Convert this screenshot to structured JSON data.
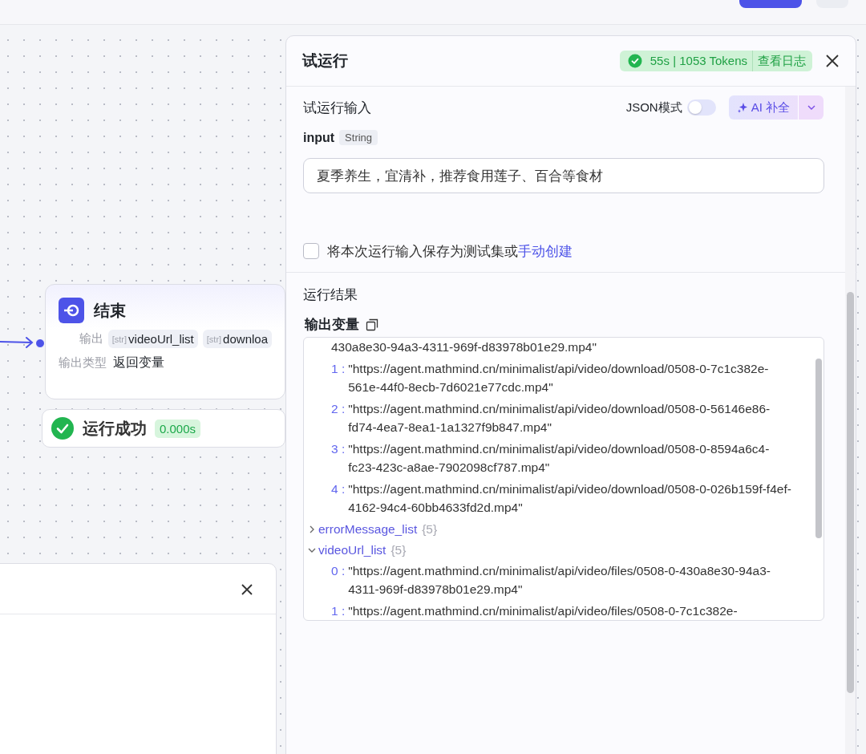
{
  "canvas": {
    "end_node": {
      "title": "结束",
      "output_label": "输出",
      "outputs": [
        {
          "type": "[str]",
          "name": "videoUrl_list"
        },
        {
          "type": "[str]",
          "name": "downloa"
        }
      ],
      "output_type_label": "输出类型",
      "output_type": "返回变量"
    },
    "run_status": {
      "text": "运行成功",
      "time": "0.000s"
    }
  },
  "test_panel": {
    "title": "试运行",
    "status": {
      "summary": "55s | 1053 Tokens",
      "log_link": "查看日志"
    },
    "input_section": {
      "title": "试运行输入",
      "json_mode_label": "JSON模式",
      "json_mode_on": false,
      "ai_button": "AI 补全"
    },
    "fields": [
      {
        "name": "input",
        "type": "String",
        "value": "夏季养生，宜清补，推荐食用莲子、百合等食材"
      }
    ],
    "save_option": {
      "checked": false,
      "text": "将本次运行输入保存为测试集或",
      "link": "手动创建"
    },
    "result": {
      "title": "运行结果",
      "output_label": "输出变量",
      "lines": [
        {
          "kind": "continuation",
          "value": "430a8e30-94a3-4311-969f-d83978b01e29.mp4\""
        },
        {
          "kind": "item",
          "index": "1 :",
          "value": "\"https://agent.mathmind.cn/minimalist/api/video/download/0508-0-7c1c382e-561e-44f0-8ecb-7d6021e77cdc.mp4\""
        },
        {
          "kind": "item",
          "index": "2 :",
          "value": "\"https://agent.mathmind.cn/minimalist/api/video/download/0508-0-56146e86-fd74-4ea7-8ea1-1a1327f9b847.mp4\""
        },
        {
          "kind": "item",
          "index": "3 :",
          "value": "\"https://agent.mathmind.cn/minimalist/api/video/download/0508-0-8594a6c4-fc23-423c-a8ae-7902098cf787.mp4\""
        },
        {
          "kind": "item",
          "index": "4 :",
          "value": "\"https://agent.mathmind.cn/minimalist/api/video/download/0508-0-026b159f-f4ef-4162-94c4-60bb4633fd2d.mp4\""
        },
        {
          "kind": "group",
          "name": "errorMessage_list",
          "count": "{5}",
          "expanded": false
        },
        {
          "kind": "group",
          "name": "videoUrl_list",
          "count": "{5}",
          "expanded": true,
          "children": [
            {
              "kind": "item",
              "index": "0 :",
              "value": "\"https://agent.mathmind.cn/minimalist/api/video/files/0508-0-430a8e30-94a3-4311-969f-d83978b01e29.mp4\""
            },
            {
              "kind": "item",
              "index": "1 :",
              "value": "\"https://agent.mathmind.cn/minimalist/api/video/files/0508-0-7c1c382e-"
            }
          ]
        }
      ]
    }
  }
}
